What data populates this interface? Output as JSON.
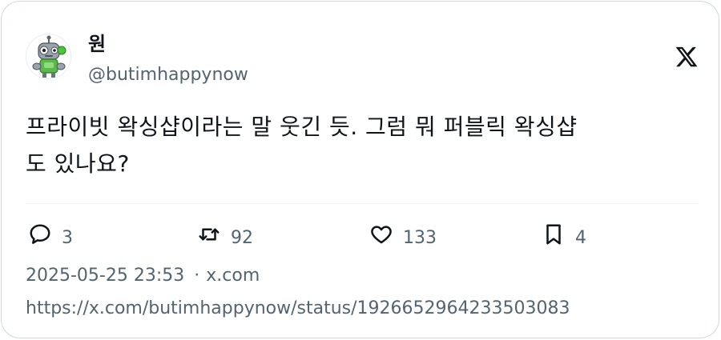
{
  "author": {
    "display_name": "원",
    "handle": "@butimhappynow"
  },
  "tweet": {
    "text": "프라이빗 왁싱샵이라는 말 웃긴 듯. 그럼 뭐 퍼블릭 왁싱샵\n도 있나요?"
  },
  "actions": {
    "reply_count": "3",
    "retweet_count": "92",
    "like_count": "133",
    "bookmark_count": "4"
  },
  "meta": {
    "timestamp": "2025-05-25 23:53",
    "separator": "·",
    "source": "x.com",
    "url": "https://x.com/butimhappynow/status/1926652964233503083"
  },
  "icons": {
    "brand": "x-logo-icon",
    "reply": "speech-bubble-icon",
    "retweet": "retweet-arrows-icon",
    "like": "heart-icon",
    "bookmark": "bookmark-icon",
    "avatar": "robot-character-avatar"
  },
  "colors": {
    "text_primary": "#0f1419",
    "text_secondary": "#536471",
    "border": "#cfd9de"
  }
}
